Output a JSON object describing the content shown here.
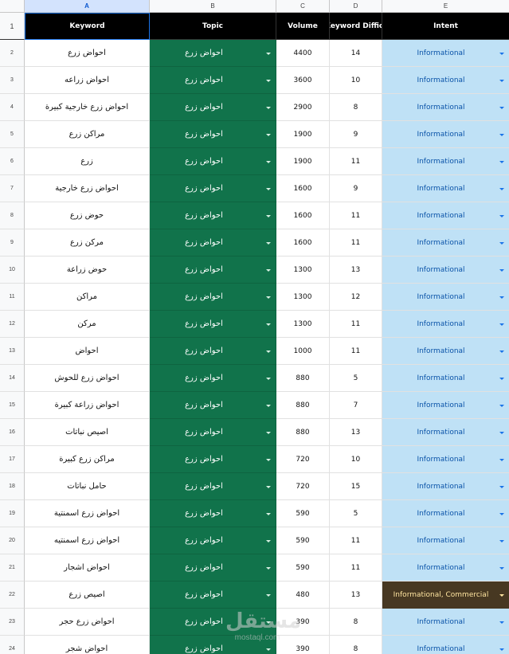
{
  "columns": [
    "A",
    "B",
    "C",
    "D",
    "E"
  ],
  "header_row": {
    "num": "1",
    "keyword": "Keyword",
    "topic": "Topic",
    "volume": "Volume",
    "difficulty": "Keyword Difficulty",
    "intent": "Intent"
  },
  "rows": [
    {
      "num": "2",
      "keyword": "احواض زرع",
      "topic": "احواض زرع",
      "volume": "4400",
      "difficulty": "14",
      "intent": "Informational"
    },
    {
      "num": "3",
      "keyword": "احواض زراعه",
      "topic": "احواض زرع",
      "volume": "3600",
      "difficulty": "10",
      "intent": "Informational"
    },
    {
      "num": "4",
      "keyword": "احواض زرع خارجية كبيرة",
      "topic": "احواض زرع",
      "volume": "2900",
      "difficulty": "8",
      "intent": "Informational"
    },
    {
      "num": "5",
      "keyword": "مراكن زرع",
      "topic": "احواض زرع",
      "volume": "1900",
      "difficulty": "9",
      "intent": "Informational"
    },
    {
      "num": "6",
      "keyword": "زرع",
      "topic": "احواض زرع",
      "volume": "1900",
      "difficulty": "11",
      "intent": "Informational"
    },
    {
      "num": "7",
      "keyword": "احواض زرع خارجية",
      "topic": "احواض زرع",
      "volume": "1600",
      "difficulty": "9",
      "intent": "Informational"
    },
    {
      "num": "8",
      "keyword": "حوض زرع",
      "topic": "احواض زرع",
      "volume": "1600",
      "difficulty": "11",
      "intent": "Informational"
    },
    {
      "num": "9",
      "keyword": "مركن زرع",
      "topic": "احواض زرع",
      "volume": "1600",
      "difficulty": "11",
      "intent": "Informational"
    },
    {
      "num": "10",
      "keyword": "حوض زراعة",
      "topic": "احواض زرع",
      "volume": "1300",
      "difficulty": "13",
      "intent": "Informational"
    },
    {
      "num": "11",
      "keyword": "مراكن",
      "topic": "احواض زرع",
      "volume": "1300",
      "difficulty": "12",
      "intent": "Informational"
    },
    {
      "num": "12",
      "keyword": "مركن",
      "topic": "احواض زرع",
      "volume": "1300",
      "difficulty": "11",
      "intent": "Informational"
    },
    {
      "num": "13",
      "keyword": "احواض",
      "topic": "احواض زرع",
      "volume": "1000",
      "difficulty": "11",
      "intent": "Informational"
    },
    {
      "num": "14",
      "keyword": "احواض زرع للحوش",
      "topic": "احواض زرع",
      "volume": "880",
      "difficulty": "5",
      "intent": "Informational"
    },
    {
      "num": "15",
      "keyword": "احواض زراعة كبيرة",
      "topic": "احواض زرع",
      "volume": "880",
      "difficulty": "7",
      "intent": "Informational"
    },
    {
      "num": "16",
      "keyword": "اصيص نباتات",
      "topic": "احواض زرع",
      "volume": "880",
      "difficulty": "13",
      "intent": "Informational"
    },
    {
      "num": "17",
      "keyword": "مراكن زرع كبيرة",
      "topic": "احواض زرع",
      "volume": "720",
      "difficulty": "10",
      "intent": "Informational"
    },
    {
      "num": "18",
      "keyword": "حامل نباتات",
      "topic": "احواض زرع",
      "volume": "720",
      "difficulty": "15",
      "intent": "Informational"
    },
    {
      "num": "19",
      "keyword": "احواض زرع اسمنتية",
      "topic": "احواض زرع",
      "volume": "590",
      "difficulty": "5",
      "intent": "Informational"
    },
    {
      "num": "20",
      "keyword": "احواض زرع اسمنتيه",
      "topic": "احواض زرع",
      "volume": "590",
      "difficulty": "11",
      "intent": "Informational"
    },
    {
      "num": "21",
      "keyword": "احواض اشجار",
      "topic": "احواض زرع",
      "volume": "590",
      "difficulty": "11",
      "intent": "Informational"
    },
    {
      "num": "22",
      "keyword": "اصيص زرع",
      "topic": "احواض زرع",
      "volume": "480",
      "difficulty": "13",
      "intent": "Informational, Commercial",
      "commercial": true
    },
    {
      "num": "23",
      "keyword": "احواض زرع حجر",
      "topic": "احواض زرع",
      "volume": "390",
      "difficulty": "8",
      "intent": "Informational"
    },
    {
      "num": "24",
      "keyword": "احواض شجر",
      "topic": "احواض زرع",
      "volume": "390",
      "difficulty": "8",
      "intent": "Informational"
    }
  ],
  "watermark": {
    "logo": "مستقل",
    "text": "mostaql.com"
  },
  "colors": {
    "topic_bg": "#11734b",
    "intent_bg": "#bfe1f6",
    "intent_commercial_bg": "#473822",
    "header_bg": "#000000"
  }
}
